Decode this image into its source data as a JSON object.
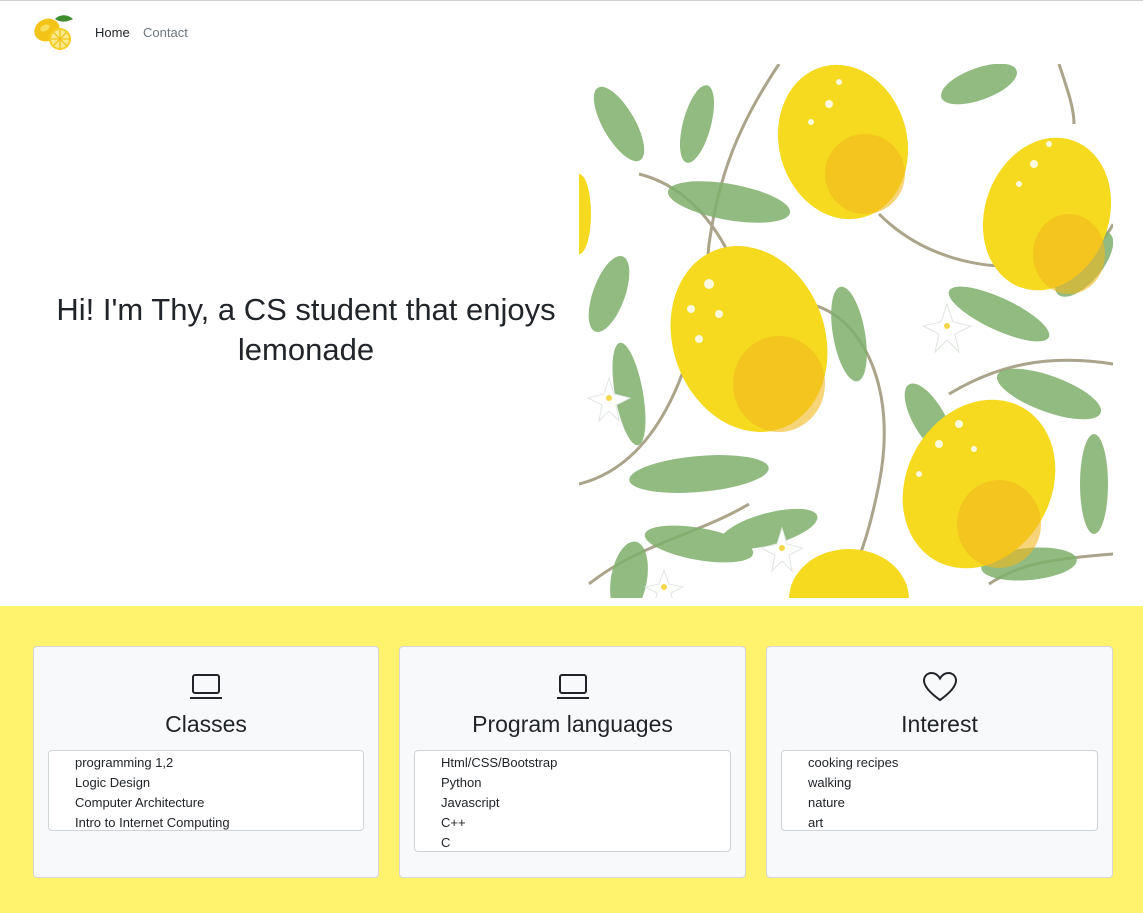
{
  "colors": {
    "section_bg": "#fff26d",
    "card_bg": "#f8f9fa",
    "text": "#212529",
    "muted_link": "#6c757d"
  },
  "nav": {
    "logo_icon": "lemon-logo",
    "links": [
      {
        "label": "Home",
        "active": true
      },
      {
        "label": "Contact",
        "active": false
      }
    ]
  },
  "hero": {
    "title": "Hi! I'm Thy, a CS student that enjoys lemonade",
    "image": "lemon-pattern-image"
  },
  "cards": [
    {
      "icon": "laptop-icon",
      "title": "Classes",
      "items": [
        "programming 1,2",
        "Logic Design",
        "Computer Architecture",
        "Intro to Internet Computing"
      ]
    },
    {
      "icon": "laptop-icon",
      "title": "Program languages",
      "items": [
        "Html/CSS/Bootstrap",
        "Python",
        "Javascript",
        "C++",
        "C"
      ]
    },
    {
      "icon": "heart-icon",
      "title": "Interest",
      "items": [
        "cooking recipes",
        "walking",
        "nature",
        "art"
      ]
    }
  ]
}
